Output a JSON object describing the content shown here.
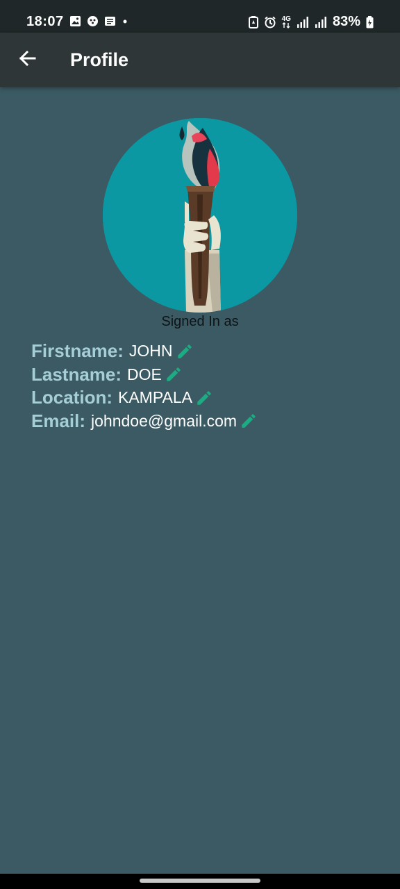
{
  "status_bar": {
    "time": "18:07",
    "network": "4G",
    "battery": "83%"
  },
  "app_bar": {
    "title": "Profile"
  },
  "profile": {
    "signed_in_text": "Signed In as",
    "fields": [
      {
        "label": "Firstname:",
        "value": "JOHN"
      },
      {
        "label": "Lastname:",
        "value": "DOE"
      },
      {
        "label": "Location:",
        "value": "KAMPALA"
      },
      {
        "label": "Email:",
        "value": "johndoe@gmail.com"
      }
    ]
  },
  "colors": {
    "background": "#3b5a63",
    "app_bar": "#2f3637",
    "status_bar": "#202728",
    "label": "#a6ced6",
    "edit_icon": "#1dab83",
    "avatar_bg": "#0b98a2"
  },
  "icons": {
    "back": "arrow-left-icon",
    "edit": "pencil-icon"
  }
}
